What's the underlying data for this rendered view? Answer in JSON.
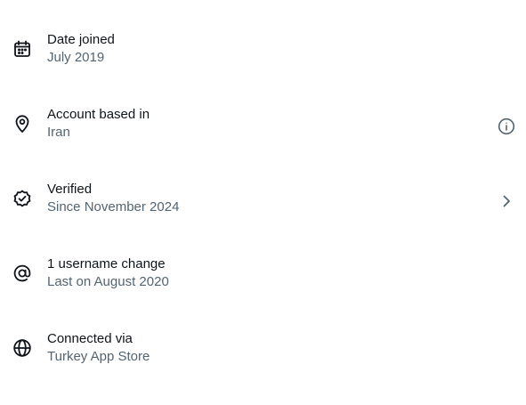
{
  "about": {
    "items": [
      {
        "icon": "calendar-icon",
        "title": "Date joined",
        "subtitle": "July 2019"
      },
      {
        "icon": "location-pin-icon",
        "title": "Account based in",
        "subtitle": "Iran",
        "trailing_icon": "info-icon"
      },
      {
        "icon": "verified-badge-icon",
        "title": "Verified",
        "subtitle": "Since November 2024",
        "trailing_icon": "chevron-right-icon"
      },
      {
        "icon": "at-sign-icon",
        "title": "1 username change",
        "subtitle": "Last on August 2020"
      },
      {
        "icon": "globe-icon",
        "title": "Connected via",
        "subtitle": "Turkey App Store"
      }
    ]
  },
  "colors": {
    "primary_text": "#0f1419",
    "secondary_text": "#536471",
    "background": "#ffffff"
  }
}
